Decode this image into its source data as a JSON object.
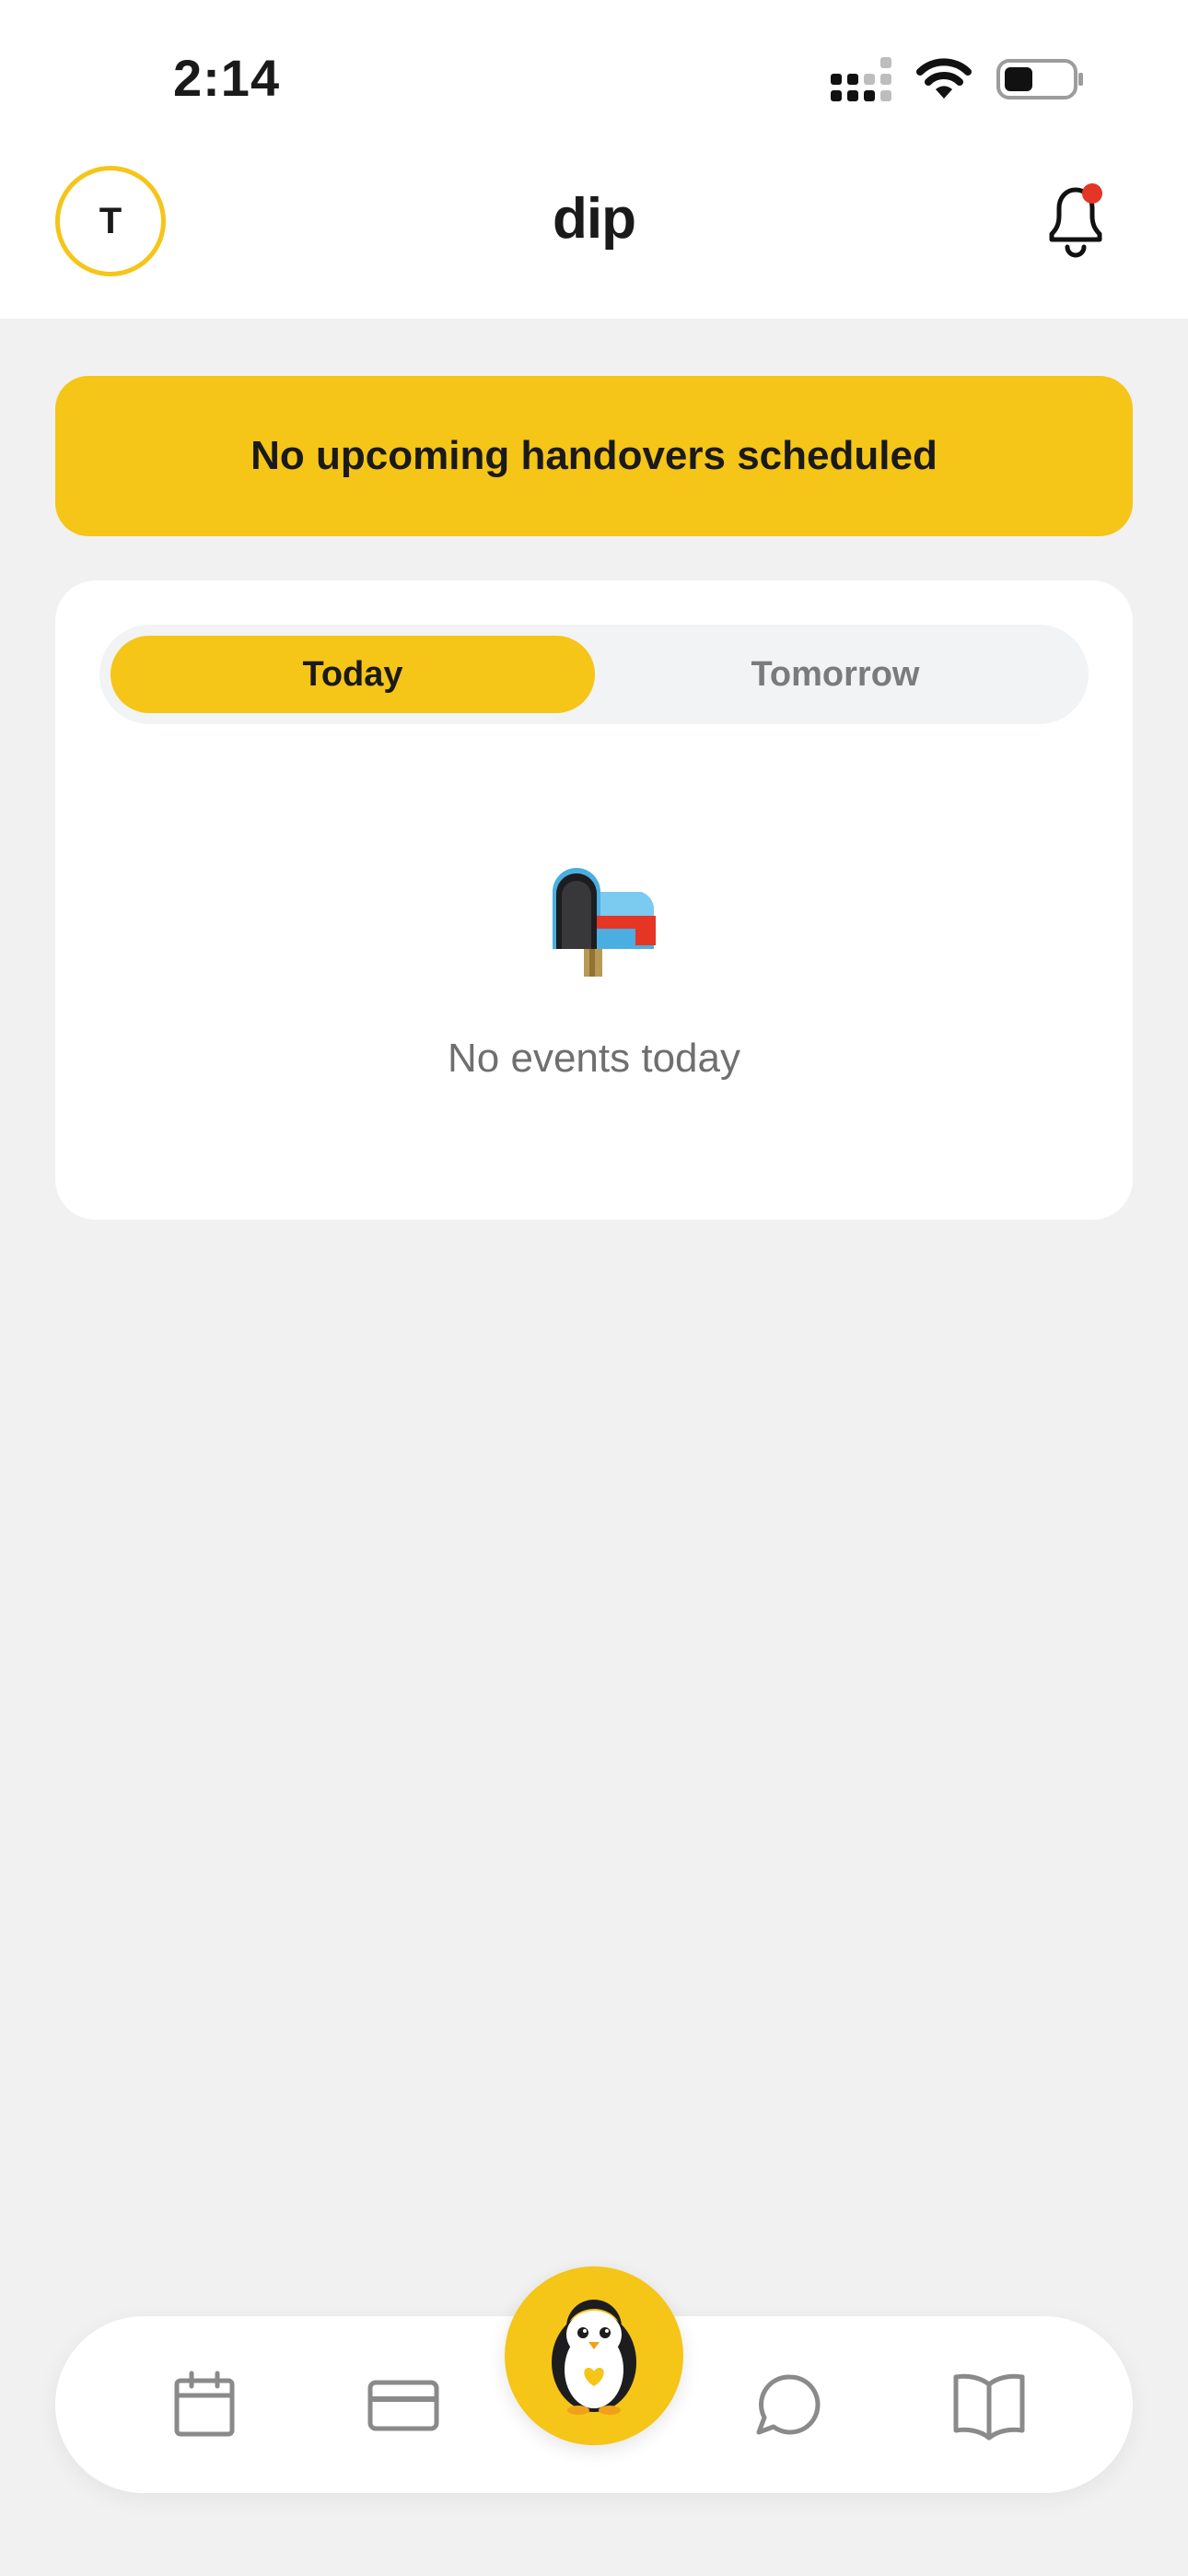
{
  "status_bar": {
    "time": "2:14"
  },
  "header": {
    "avatar_initial": "T",
    "app_title": "dip",
    "notifications_unread": true
  },
  "banner": {
    "text": "No upcoming handovers scheduled"
  },
  "day_tabs": {
    "items": [
      "Today",
      "Tomorrow"
    ],
    "selected": "Today"
  },
  "events": {
    "empty_message": "No events today",
    "empty_icon": "mailbox-icon"
  },
  "bottom_nav": {
    "items": [
      "calendar-icon",
      "card-icon",
      "penguin-icon",
      "chat-icon",
      "book-icon"
    ],
    "center": "penguin-icon"
  },
  "colors": {
    "accent": "#f5c518",
    "background": "#f1f1f2",
    "badge": "#e53525"
  }
}
